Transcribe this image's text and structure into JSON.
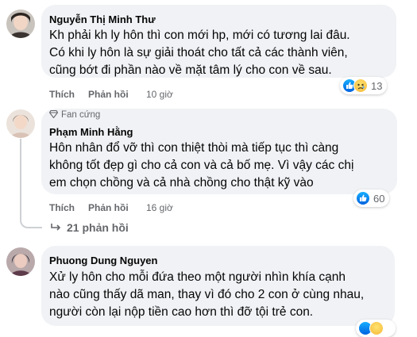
{
  "comments": [
    {
      "author": "Nguyễn Thị Minh Thư",
      "lines": [
        "Kh phải kh ly hôn thì con mới hp, mới có tương lai đâu.",
        "Có khi ly hôn là sự giải thoát cho tất cả các thành viên,",
        "cũng bớt đi phần nào về mặt tâm lý cho con về sau."
      ],
      "like_label": "Thích",
      "reply_label": "Phản hồi",
      "time": "10 giờ",
      "reaction_count": "13",
      "reaction_icons": [
        "like-icon",
        "sad-icon"
      ]
    },
    {
      "badge": "Fan cứng",
      "author": "Phạm Minh Hằng",
      "lines": [
        "Hôn nhân đổ vỡ thì con thiệt thòi mà tiếp tục thì càng",
        "không tốt đẹp gì cho cả con và cả bố mẹ. Vì vậy các chị",
        "em chọn chồng và cả nhà chồng cho thật kỹ vào"
      ],
      "like_label": "Thích",
      "reply_label": "Phản hồi",
      "time": "16 giờ",
      "reaction_count": "60",
      "reaction_icons": [
        "like-icon"
      ],
      "replies_label": "21 phản hồi"
    },
    {
      "author": "Phuong Dung Nguyen",
      "lines": [
        "Xử ly hôn cho mỗi đứa theo một người nhìn khía cạnh",
        "nào cũng thấy dã man, thay vì đó cho 2 con ở cùng nhau,",
        "người còn lại nộp tiền cao hơn thì đỡ tội trẻ con."
      ]
    }
  ],
  "colors": {
    "bubble": "#f0f2f5",
    "secondary_text": "#65676b",
    "like_blue": "#1877f2"
  }
}
